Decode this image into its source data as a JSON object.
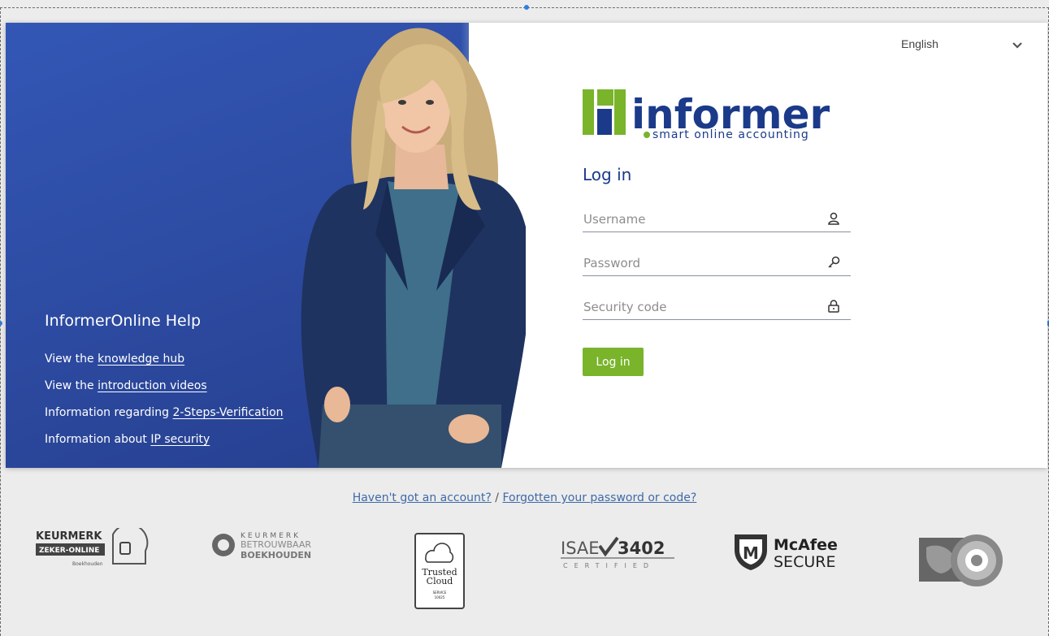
{
  "language": {
    "selected": "English"
  },
  "brand": {
    "name": "informer",
    "tagline": "smart online accounting"
  },
  "help": {
    "title": "InformerOnline Help",
    "lines": [
      {
        "prefix": "View the ",
        "link": "knowledge hub"
      },
      {
        "prefix": "View the ",
        "link": "introduction videos"
      },
      {
        "prefix": "Information regarding ",
        "link": "2-Steps-Verification"
      },
      {
        "prefix": "Information about ",
        "link": "IP security"
      }
    ]
  },
  "login": {
    "title": "Log in",
    "username_placeholder": "Username",
    "password_placeholder": "Password",
    "security_placeholder": "Security code",
    "button_label": "Log in"
  },
  "footer": {
    "no_account": "Haven't got an account?",
    "separator": " / ",
    "forgot": "Forgotten your password or code?"
  },
  "badges": {
    "keurmerk1_top": "KEURMERK",
    "keurmerk1_band": "ZEKER-ONLINE",
    "keurmerk1_sub": "Boekhouden",
    "keurmerk2_line1": "KEURMERK",
    "keurmerk2_line2": "BETROUWBAAR",
    "keurmerk2_line3": "BOEKHOUDEN",
    "trusted_line1": "Trusted",
    "trusted_line2": "Cloud",
    "trusted_line3": "SERVICE",
    "trusted_line4": "10025",
    "isae_left": "ISAE",
    "isae_right": "3402",
    "isae_sub": "CERTIFIED",
    "mcafee_line1": "McAfee",
    "mcafee_line2": "SECURE"
  },
  "colors": {
    "brand_green": "#79b42b",
    "brand_blue": "#1b3a8a",
    "hero_blue": "#2d4ea8"
  }
}
